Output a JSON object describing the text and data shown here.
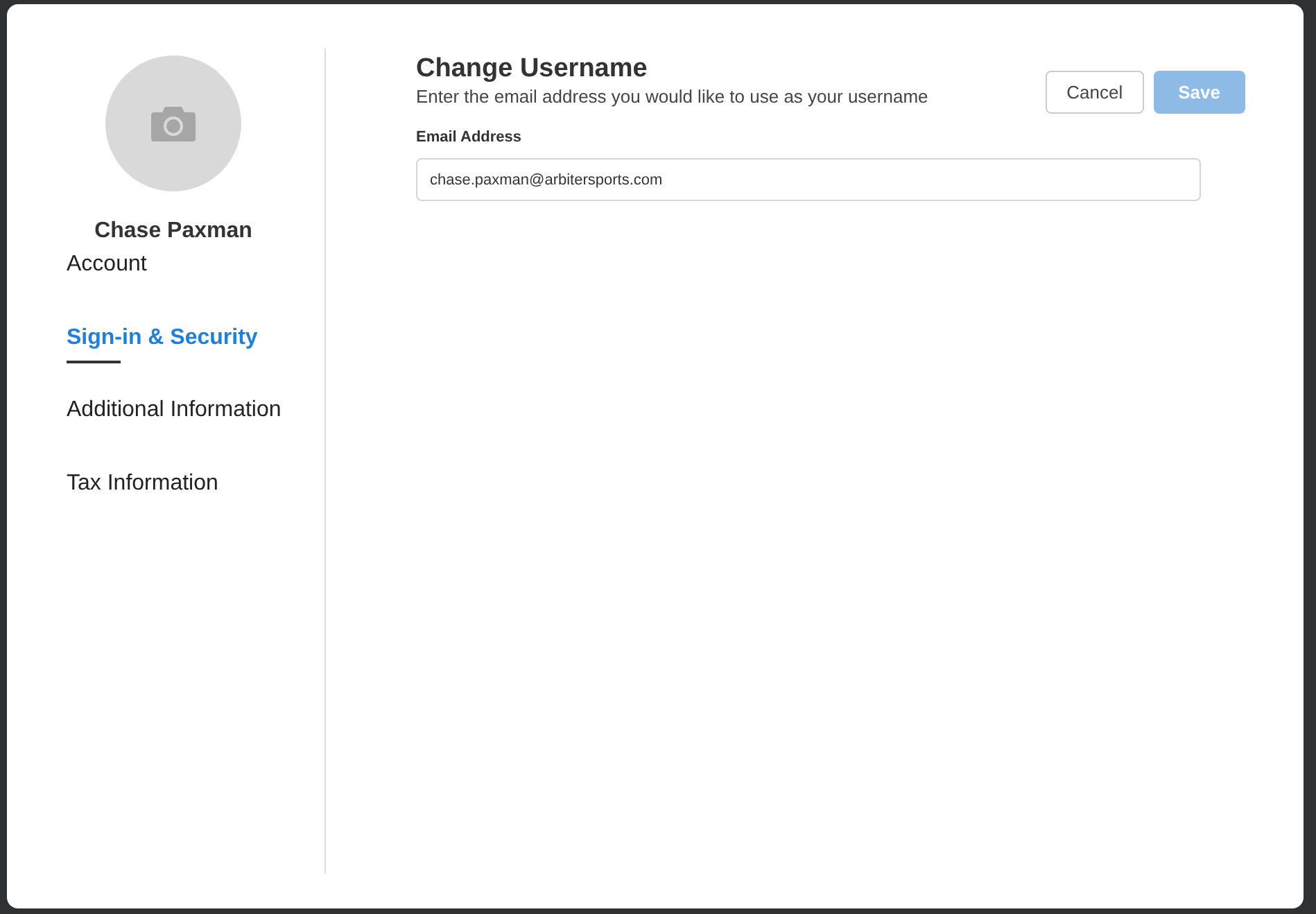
{
  "profile": {
    "name": "Chase Paxman"
  },
  "nav": [
    {
      "label": "Account",
      "selected": false
    },
    {
      "label": "Sign-in & Security",
      "selected": true
    },
    {
      "label": "Additional Information",
      "selected": false
    },
    {
      "label": "Tax Information",
      "selected": false
    }
  ],
  "header": {
    "title": "Change Username",
    "subtitle": "Enter the email address you would like to use as your username"
  },
  "buttons": [
    {
      "kind": "secondary",
      "label": "Cancel",
      "disabled": false
    },
    {
      "kind": "primary",
      "label": "Save",
      "disabled": true
    }
  ],
  "field": {
    "label": "Email Address",
    "value": "chase.paxman@arbitersports.com"
  }
}
